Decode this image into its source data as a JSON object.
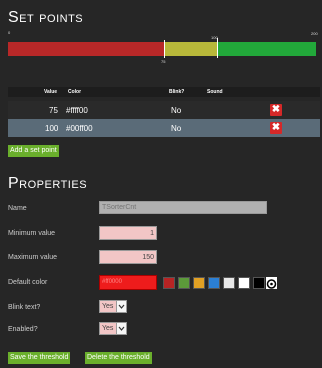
{
  "setpoints_title": "Set points",
  "scale": {
    "min": "0",
    "mid": "100",
    "max": "200",
    "marker": "75"
  },
  "table": {
    "headers": {
      "value": "Value",
      "color": "Color",
      "blink": "Blink?",
      "sound": "Sound"
    },
    "rows": [
      {
        "value": "75",
        "color": "#ffff00",
        "blink": "No",
        "delete": "✖"
      },
      {
        "value": "100",
        "color": "#00ff00",
        "blink": "No",
        "delete": "✖"
      }
    ]
  },
  "add_setpoint_label": "Add a set point",
  "properties_title": "Properties",
  "properties": {
    "name": {
      "label": "Name",
      "placeholder": "TSorterCnt"
    },
    "min": {
      "label": "Minimum value",
      "value": "1"
    },
    "max": {
      "label": "Maximum value",
      "value": "150"
    },
    "default_color": {
      "label": "Default color",
      "value": "#ff0000"
    },
    "blink": {
      "label": "Blink text?",
      "value": "Yes"
    },
    "enabled": {
      "label": "Enabled?",
      "value": "Yes"
    }
  },
  "swatches": [
    "#b72424",
    "#5c9a3a",
    "#e0a024",
    "#2b7fd4",
    "#e8e8e8",
    "#ffffff",
    "#000000"
  ],
  "buttons": {
    "save": "Save the threshold",
    "delete": "Delete the threshold"
  }
}
